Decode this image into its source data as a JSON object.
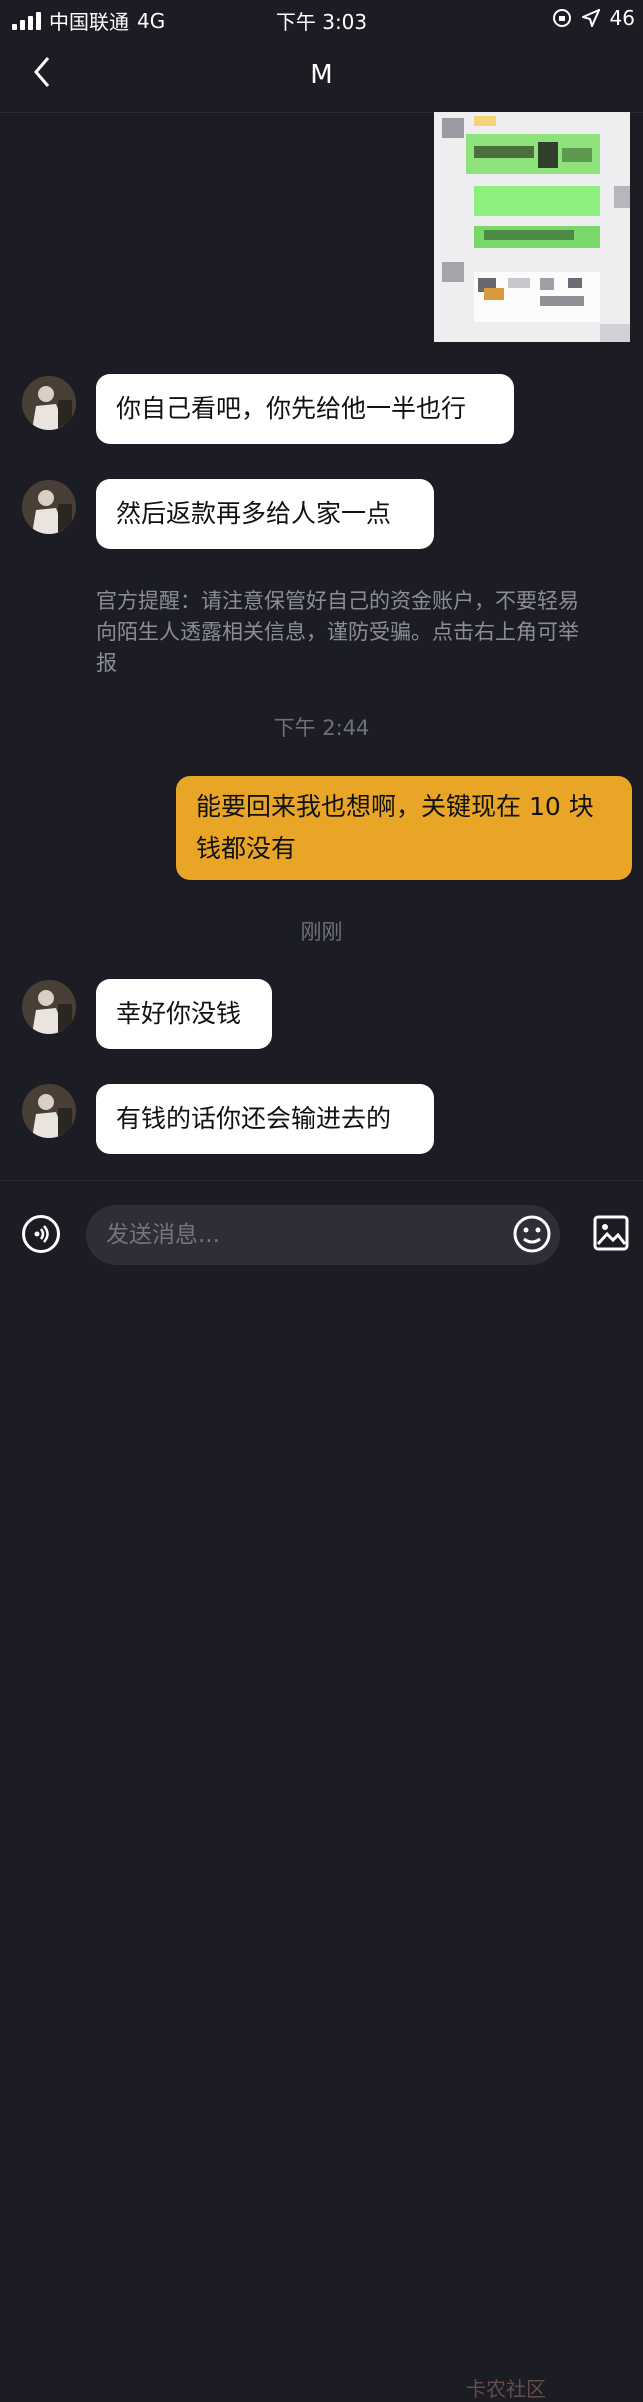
{
  "status_bar": {
    "carrier": "中国联通",
    "network": "4G",
    "time": "下午 3:03",
    "right_text": "46"
  },
  "header": {
    "title": "M"
  },
  "messages": [
    {
      "side": "left",
      "text": "你自己看吧，你先给他一半也行"
    },
    {
      "side": "left",
      "text": "然后返款再多给人家一点"
    },
    {
      "side": "right",
      "line1": "能要回来我也想啊，关键现在 10 块",
      "line2": "钱都没有"
    },
    {
      "side": "left",
      "text": "幸好你没钱"
    },
    {
      "side": "left",
      "text": "有钱的话你还会输进去的"
    }
  ],
  "notice": {
    "line1": "官方提醒：请注意保管好自己的资金账户，不要轻易",
    "line2": "向陌生人透露相关信息，谨防受骗。点击右上角可举",
    "line3": "报"
  },
  "timestamps": [
    "下午 2:44",
    "刚刚"
  ],
  "input": {
    "placeholder": "发送消息..."
  },
  "watermark": {
    "text": "卡农社区"
  },
  "colors": {
    "background": "#1b1c24",
    "my_bubble": "#e9a626",
    "their_bubble": "#ffffff"
  }
}
